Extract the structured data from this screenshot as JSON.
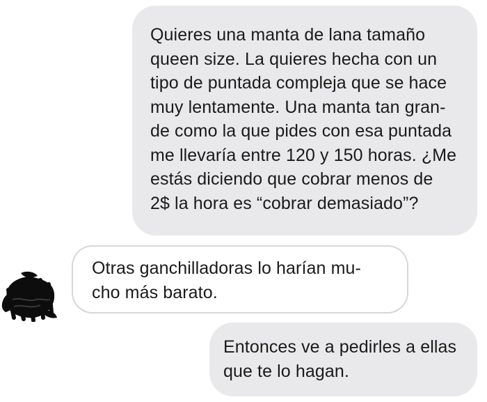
{
  "conversation": {
    "messages": [
      {
        "sender": "self",
        "lines": [
          "Quieres una manta de lana tamaño",
          "queen size. La quieres hecha con un",
          "tipo de puntada compleja que se hace",
          "muy lentamente. Una manta tan gran-",
          "de como la que pides con esa puntada",
          "me llevaría entre 120 y 150 horas. ¿Me",
          "estás diciendo que cobrar menos de",
          "2$ la hora es “cobrar demasiado”?"
        ]
      },
      {
        "sender": "other",
        "lines": [
          "Otras ganchilladoras lo harían mu-",
          "cho más barato."
        ]
      },
      {
        "sender": "self",
        "lines": [
          "Entonces ve a pedirles a ellas",
          "que te lo hagan."
        ]
      }
    ]
  },
  "colors": {
    "sent_bubble": "#e9e9eb",
    "received_bubble": "#ffffff",
    "received_border": "#d7d7d7",
    "avatar_scribble": "#0d0d0d"
  }
}
